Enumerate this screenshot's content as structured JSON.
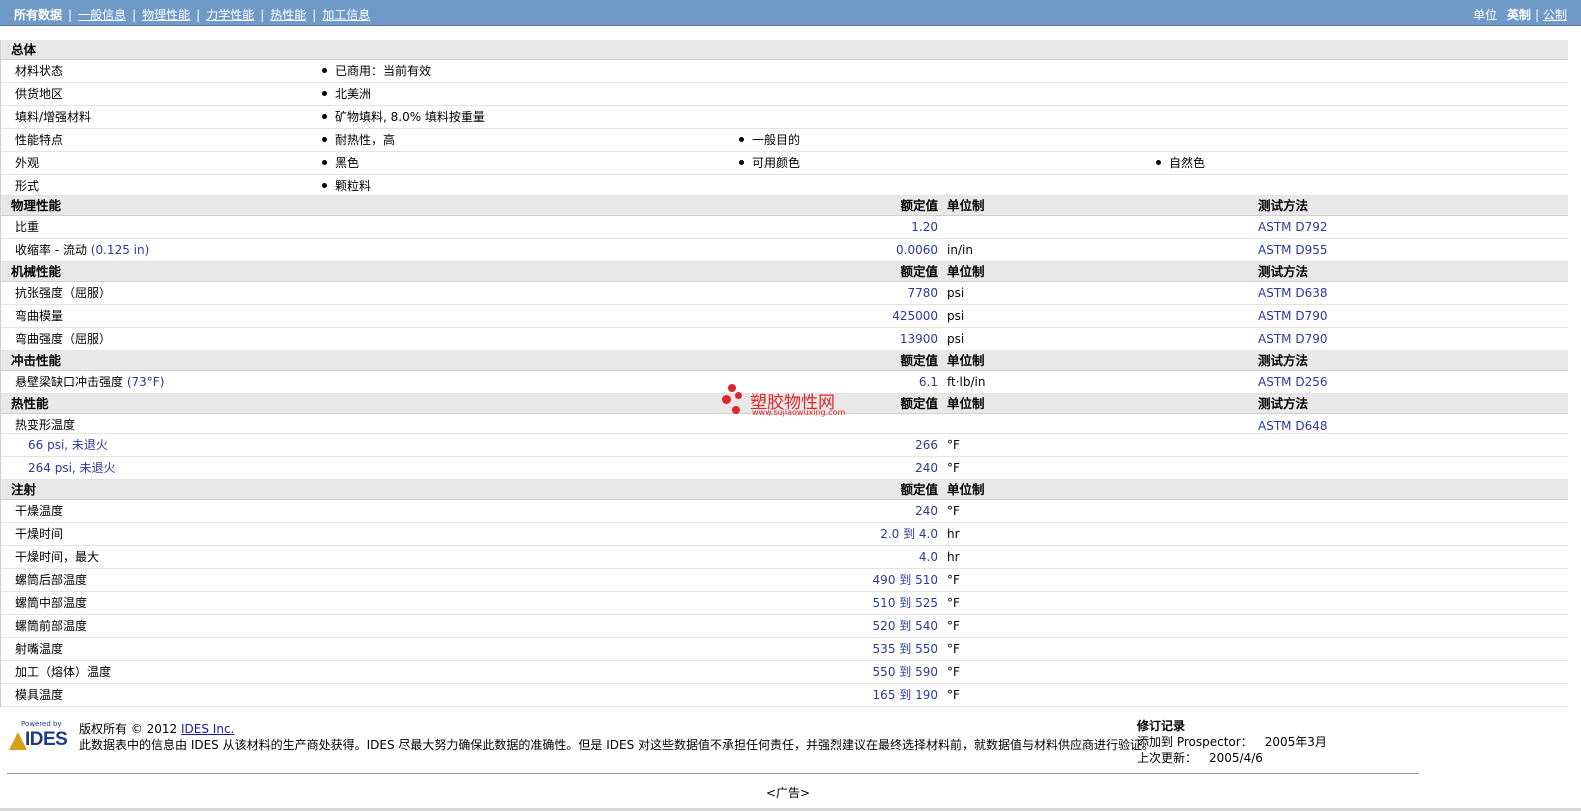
{
  "nav": {
    "items": [
      {
        "label": "所有数据",
        "selected": true
      },
      {
        "label": "一般信息",
        "selected": false
      },
      {
        "label": "物理性能",
        "selected": false
      },
      {
        "label": "力学性能",
        "selected": false
      },
      {
        "label": "热性能",
        "selected": false
      },
      {
        "label": "加工信息",
        "selected": false
      }
    ],
    "unit_label": "单位",
    "unit_imperial": "英制",
    "unit_metric": "公制"
  },
  "headers": {
    "rated": "额定值",
    "unit": "单位制",
    "test": "测试方法"
  },
  "general": {
    "title": "总体",
    "rows": [
      {
        "label": "材料状态",
        "values": [
          "已商用：当前有效"
        ]
      },
      {
        "label": "供货地区",
        "values": [
          "北美洲"
        ]
      },
      {
        "label": "填料/增强材料",
        "values": [
          "矿物填料, 8.0% 填料按重量"
        ]
      },
      {
        "label": "性能特点",
        "values": [
          "耐热性，高",
          "一般目的"
        ]
      },
      {
        "label": "外观",
        "values": [
          "黑色",
          "可用颜色",
          "自然色"
        ]
      },
      {
        "label": "形式",
        "values": [
          "颗粒料"
        ]
      }
    ]
  },
  "physical": {
    "title": "物理性能",
    "rows": [
      {
        "label": "比重",
        "condition": "",
        "value": "1.20",
        "unit": "",
        "test": "ASTM D792"
      },
      {
        "label": "收缩率 - 流动",
        "condition": "(0.125 in)",
        "value": "0.0060",
        "unit": "in/in",
        "test": "ASTM D955"
      }
    ]
  },
  "mechanical": {
    "title": "机械性能",
    "rows": [
      {
        "label": "抗张强度（屈服）",
        "value": "7780",
        "unit": "psi",
        "test": "ASTM D638"
      },
      {
        "label": "弯曲模量",
        "value": "425000",
        "unit": "psi",
        "test": "ASTM D790"
      },
      {
        "label": "弯曲强度（屈服）",
        "value": "13900",
        "unit": "psi",
        "test": "ASTM D790"
      }
    ]
  },
  "impact": {
    "title": "冲击性能",
    "rows": [
      {
        "label": "悬壁梁缺口冲击强度",
        "condition": "(73°F)",
        "value": "6.1",
        "unit": "ft·lb/in",
        "test": "ASTM D256"
      }
    ]
  },
  "thermal": {
    "title": "热性能",
    "rows": [
      {
        "label": "热变形温度",
        "value": "",
        "unit": "",
        "test": "ASTM D648",
        "sub": false
      },
      {
        "label": "66 psi, 未退火",
        "value": "266",
        "unit": "°F",
        "test": "",
        "sub": true
      },
      {
        "label": "264 psi, 未退火",
        "value": "240",
        "unit": "°F",
        "test": "",
        "sub": true
      }
    ]
  },
  "injection": {
    "title": "注射",
    "rows": [
      {
        "label": "干燥温度",
        "value": "240",
        "unit": "°F"
      },
      {
        "label": "干燥时间",
        "value": "2.0 到 4.0",
        "unit": "hr"
      },
      {
        "label": "干燥时间，最大",
        "value": "4.0",
        "unit": "hr"
      },
      {
        "label": "螺筒后部温度",
        "value": "490 到 510",
        "unit": "°F"
      },
      {
        "label": "螺筒中部温度",
        "value": "510 到 525",
        "unit": "°F"
      },
      {
        "label": "螺筒前部温度",
        "value": "520 到 540",
        "unit": "°F"
      },
      {
        "label": "射嘴温度",
        "value": "535 到 550",
        "unit": "°F"
      },
      {
        "label": "加工（熔体）温度",
        "value": "550 到 590",
        "unit": "°F"
      },
      {
        "label": "模具温度",
        "value": "165 到 190",
        "unit": "°F"
      }
    ]
  },
  "watermark": {
    "name": "塑胶物性网",
    "url": "www.sujiaowuxing.com",
    "color": "#e0262a"
  },
  "footer": {
    "logo_powered": "Powered by",
    "logo_name": "IDES",
    "copyright_prefix": "版权所有 © 2012",
    "copyright_link": "IDES Inc.",
    "disclaimer": "此数据表中的信息由 IDES 从该材料的生产商处获得。IDES 尽最大努力确保此数据的准确性。但是 IDES 对这些数据值不承担任何责任，并强烈建议在最终选择材料前，就数据值与材料供应商进行验证。",
    "revision_title": "修订记录",
    "added_label": "添加到 Prospector：",
    "added_value": "2005年3月",
    "updated_label": "上次更新：",
    "updated_value": "2005/4/6",
    "ad": "<广告>"
  },
  "colors": {
    "nav_bg": "#6f9ac7",
    "section_bg": "#e8e8e8",
    "link": "#1a1aa6"
  }
}
